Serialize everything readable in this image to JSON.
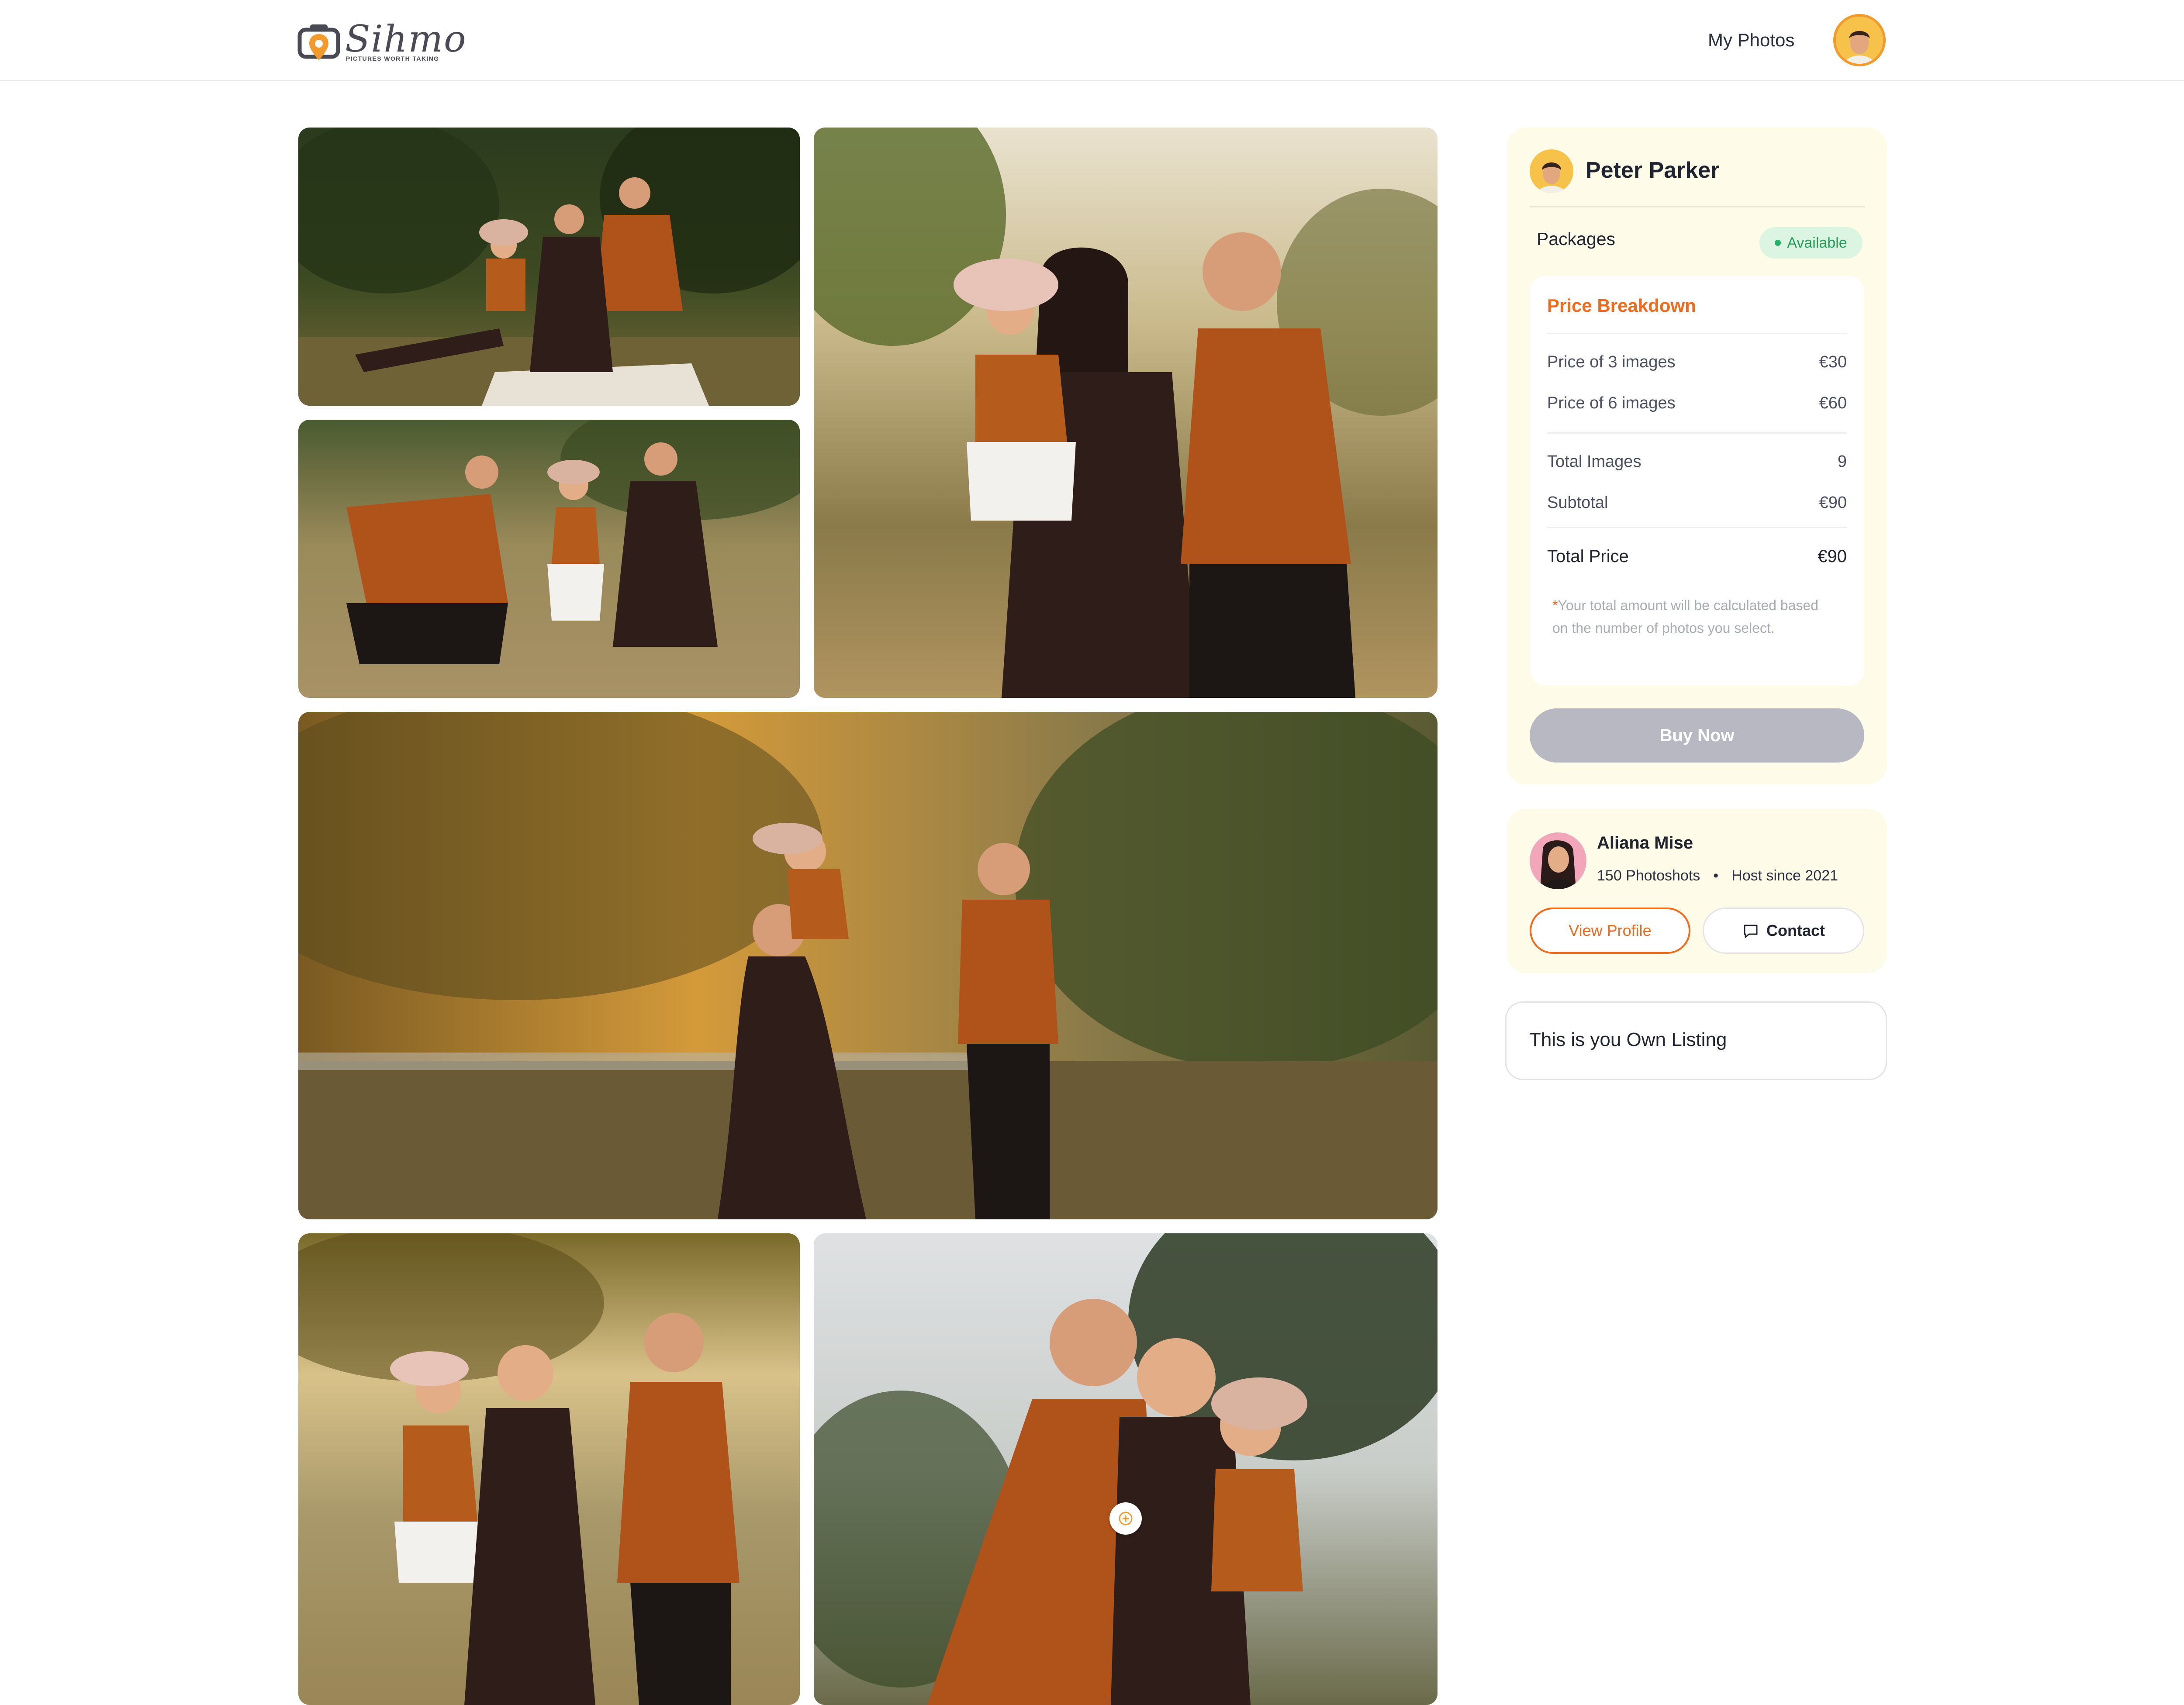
{
  "header": {
    "logo": {
      "wordmark": "Sihmo",
      "tagline": "PICTURES WORTH TAKING"
    },
    "nav_link": "My Photos"
  },
  "gallery": {
    "photos": [
      {
        "alt": "Family picnic in autumn forest"
      },
      {
        "alt": "Family crouching together in a meadow"
      },
      {
        "alt": "Parents holding toddler in tall grass"
      },
      {
        "alt": "Mother lifting child at sunset"
      },
      {
        "alt": "Family playing in golden field"
      },
      {
        "alt": "Family hugging under pine trees"
      }
    ]
  },
  "pricing": {
    "owner_name": "Peter Parker",
    "packages_label": "Packages",
    "status_badge": "Available",
    "breakdown_title": "Price Breakdown",
    "rows": [
      {
        "label": "Price of 3 images",
        "value": "€30"
      },
      {
        "label": "Price of 6 images",
        "value": "€60"
      },
      {
        "label": "Total Images",
        "value": "9"
      },
      {
        "label": "Subtotal",
        "value": "€90"
      },
      {
        "label": "Total Price",
        "value": "€90"
      }
    ],
    "note_star": "*",
    "note": "Your total amount will be calculated based on the number of photos you select.",
    "buy_label": "Buy Now"
  },
  "host": {
    "name": "Aliana Mise",
    "photoshoots": "150 Photoshots",
    "separator": "•",
    "host_since": "Host since 2021",
    "view_profile_label": "View Profile",
    "contact_label": "Contact"
  },
  "own_listing_text": "This is you Own Listing",
  "colors": {
    "accent": "#f26a1b",
    "available_bg": "#dcf5e2",
    "available_text": "#1f9d55",
    "card_bg": "#fefbe8",
    "buy_disabled": "#b7b8c2"
  }
}
